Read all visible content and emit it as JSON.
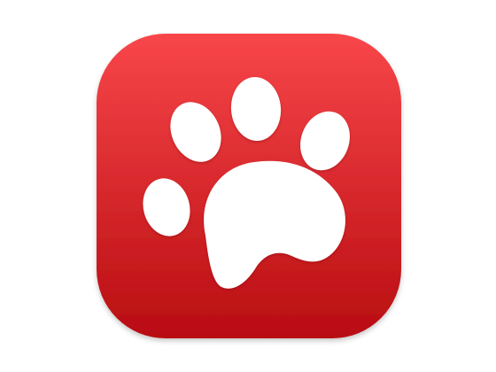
{
  "app_icon": {
    "icon": "paw-print-icon",
    "colors": {
      "background": "#ffffff",
      "tile_top": "#f8464a",
      "tile_bottom": "#b80d11",
      "paw": "#ffffff"
    }
  }
}
